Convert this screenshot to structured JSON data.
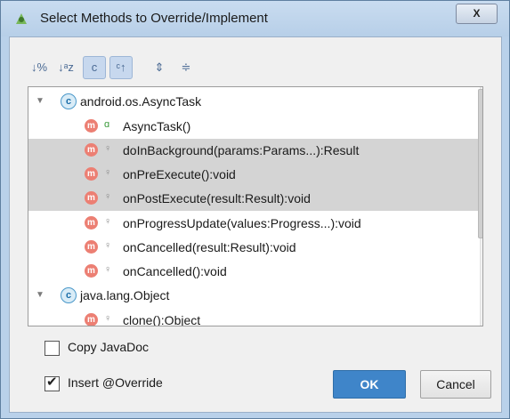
{
  "window": {
    "title": "Select Methods to Override/Implement",
    "close_label": "X",
    "app_icon": "android-studio-icon"
  },
  "toolbar": {
    "buttons": [
      {
        "icon": "sort-by-visibility-icon",
        "glyph": "↓%",
        "pressed": false
      },
      {
        "icon": "sort-alphabetically-icon",
        "glyph": "↓ᵃz",
        "pressed": false
      },
      {
        "icon": "show-classes-icon",
        "glyph": "c",
        "pressed": true
      },
      {
        "icon": "show-inherited-icon",
        "glyph": "ᶜ↑",
        "pressed": true
      },
      {
        "icon": "expand-all-icon",
        "glyph": "⇕",
        "pressed": false
      },
      {
        "icon": "collapse-all-icon",
        "glyph": "≑",
        "pressed": false
      }
    ]
  },
  "tree": {
    "groups": [
      {
        "class_icon": "c",
        "label": "android.os.AsyncTask",
        "expanded": true
      },
      {
        "class_icon": "c",
        "label": "java.lang.Object",
        "expanded": true
      }
    ],
    "methods": [
      {
        "label": "AsyncTask()",
        "visibility": "public",
        "selected": false
      },
      {
        "label": "doInBackground(params:Params...):Result",
        "visibility": "protected",
        "selected": true
      },
      {
        "label": "onPreExecute():void",
        "visibility": "protected",
        "selected": true
      },
      {
        "label": "onPostExecute(result:Result):void",
        "visibility": "protected",
        "selected": true
      },
      {
        "label": "onProgressUpdate(values:Progress...):void",
        "visibility": "protected",
        "selected": false
      },
      {
        "label": "onCancelled(result:Result):void",
        "visibility": "protected",
        "selected": false
      },
      {
        "label": "onCancelled():void",
        "visibility": "protected",
        "selected": false
      },
      {
        "label": "clone():Object",
        "visibility": "protected",
        "selected": false
      }
    ],
    "method_icon": "m",
    "visibility_glyphs": {
      "public": "ɑ",
      "protected": "♀"
    }
  },
  "options": {
    "copy_javadoc": {
      "label": "Copy JavaDoc",
      "checked": false
    },
    "insert_override": {
      "label": "Insert @Override",
      "checked": true
    }
  },
  "buttons": {
    "ok": "OK",
    "cancel": "Cancel"
  },
  "colors": {
    "accent": "#3f85c9",
    "method_icon": "#ec7f73",
    "selection": "#d4d4d4"
  }
}
